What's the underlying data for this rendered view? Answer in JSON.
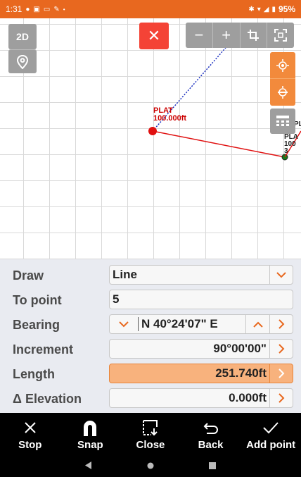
{
  "status_bar": {
    "time": "1:31",
    "battery": "95%",
    "left_icons": [
      "notification-icon",
      "gallery-icon",
      "message-icon",
      "edit-icon",
      "dot-icon"
    ],
    "right_icons": [
      "bluetooth-icon",
      "wifi-icon",
      "signal-icon"
    ]
  },
  "map": {
    "mode_label": "2D",
    "close_symbol": "✕",
    "zoom_out": "−",
    "zoom_in": "+",
    "point_a": {
      "name": "PLAT",
      "value": "100.000ft"
    },
    "point_b": {
      "name": "PL",
      "name2": "PLA",
      "value": "100",
      "number": "3"
    }
  },
  "form": {
    "draw": {
      "label": "Draw",
      "value": "Line"
    },
    "to_point": {
      "label": "To point",
      "value": "5"
    },
    "bearing": {
      "label": "Bearing",
      "value": "N 40°24'07\" E"
    },
    "increment": {
      "label": "Increment",
      "value": "90°00'00\""
    },
    "length": {
      "label": "Length",
      "value": "251.740ft"
    },
    "elevation": {
      "label": "Δ Elevation",
      "value": "0.000ft"
    }
  },
  "toolbar": {
    "stop": "Stop",
    "snap": "Snap",
    "close": "Close",
    "back": "Back",
    "add_point": "Add point"
  },
  "colors": {
    "accent": "#e8681f",
    "highlight_field": "#f8b27d",
    "line_red": "#e01010",
    "line_blue": "#1a2fc0"
  }
}
